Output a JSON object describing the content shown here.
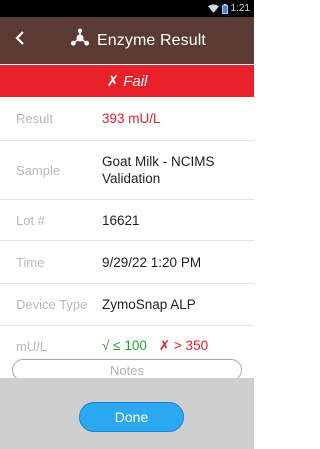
{
  "status_bar": {
    "time": "1:21",
    "icons": [
      "wifi-icon",
      "battery-icon"
    ]
  },
  "header": {
    "back_icon": "chevron-left-icon",
    "logo_icon": "enzyme-molecule-icon",
    "title": "Enzyme Result"
  },
  "result_banner": {
    "symbol": "✗",
    "text": "Fail",
    "color": "#e8202a"
  },
  "details": {
    "result": {
      "label": "Result",
      "value": "393 mU/L"
    },
    "sample": {
      "label": "Sample",
      "value_line1": "Goat Milk - NCIMS",
      "value_line2": "Validation"
    },
    "lot": {
      "label": "Lot #",
      "value": "16621"
    },
    "time": {
      "label": "Time",
      "value": "9/29/22 1:20 PM"
    },
    "device": {
      "label": "Device Type",
      "value": "ZymoSnap ALP"
    },
    "mu": {
      "label": "mU/L",
      "pass": "√ ≤ 100",
      "fail": "✗ > 350"
    }
  },
  "notes_button": {
    "label": "Notes"
  },
  "done_button": {
    "label": "Done"
  },
  "colors": {
    "header_bg": "#5b3a33",
    "fail_red": "#e8202a",
    "pass_green": "#29a33a",
    "accent_blue": "#2aa9f0"
  }
}
